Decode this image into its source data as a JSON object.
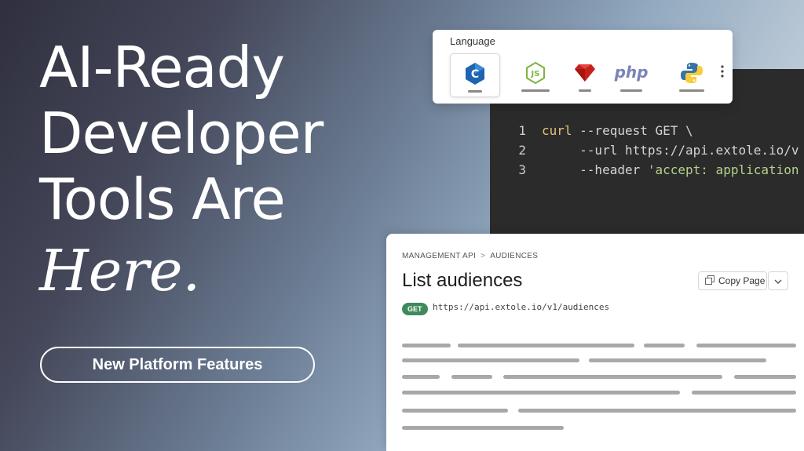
{
  "hero": {
    "line1": "AI-Ready",
    "line2": "Developer",
    "line3": "Tools Are",
    "italic": "Here."
  },
  "cta": {
    "label": "New Platform Features"
  },
  "language_picker": {
    "title": "Language",
    "items": [
      {
        "icon": "c-icon",
        "selected": true
      },
      {
        "icon": "nodejs-icon",
        "selected": false
      },
      {
        "icon": "ruby-icon",
        "selected": false
      },
      {
        "icon": "php-icon",
        "label": "php",
        "selected": false
      },
      {
        "icon": "python-icon",
        "selected": false
      }
    ]
  },
  "code": {
    "lines": [
      {
        "n": "1",
        "text": "curl --request GET \\"
      },
      {
        "n": "2",
        "text": "     --url https://api.extole.io/v"
      },
      {
        "n": "3",
        "text": "     --header 'accept: application"
      }
    ]
  },
  "docs": {
    "breadcrumb": [
      "MANAGEMENT API",
      "AUDIENCES"
    ],
    "title": "List audiences",
    "copy_label": "Copy Page",
    "method": "GET",
    "endpoint": "https://api.extole.io/v1/audiences"
  },
  "colors": {
    "method_badge": "#3f8a5b",
    "code_bg": "#2b2b2b",
    "keyword": "#e6c07b",
    "string": "#b4d28a"
  }
}
